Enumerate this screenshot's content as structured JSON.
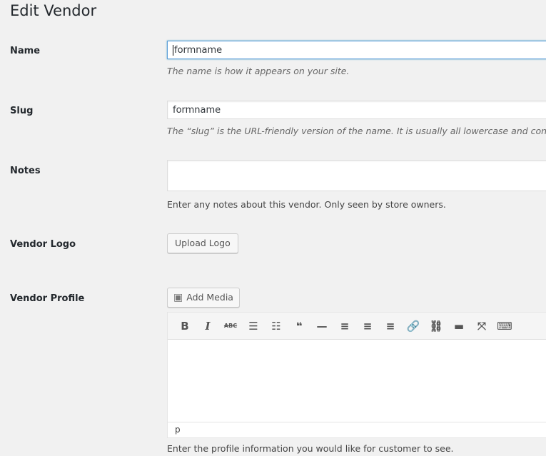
{
  "title": "Edit Vendor",
  "fields": {
    "name": {
      "label": "Name",
      "value": "formname",
      "description": "The name is how it appears on your site."
    },
    "slug": {
      "label": "Slug",
      "value": "formname",
      "description": "The “slug” is the URL-friendly version of the name. It is usually all lowercase and contain"
    },
    "notes": {
      "label": "Notes",
      "value": "",
      "description": "Enter any notes about this vendor. Only seen by store owners."
    },
    "logo": {
      "label": "Vendor Logo",
      "button": "Upload Logo"
    },
    "profile": {
      "label": "Vendor Profile",
      "add_media": "Add Media",
      "status_path": "p",
      "description": "Enter the profile information you would like for customer to see."
    }
  },
  "toolbar": [
    {
      "icon": "bold-icon",
      "glyph": "B"
    },
    {
      "icon": "italic-icon",
      "glyph": "I"
    },
    {
      "icon": "strikethrough-icon",
      "glyph": "ABC"
    },
    {
      "icon": "bullet-list-icon",
      "glyph": "☰"
    },
    {
      "icon": "numbered-list-icon",
      "glyph": "☷"
    },
    {
      "icon": "blockquote-icon",
      "glyph": "❝"
    },
    {
      "icon": "horizontal-line-icon",
      "glyph": "—"
    },
    {
      "icon": "align-left-icon",
      "glyph": "≡"
    },
    {
      "icon": "align-center-icon",
      "glyph": "≡"
    },
    {
      "icon": "align-right-icon",
      "glyph": "≡"
    },
    {
      "icon": "link-icon",
      "glyph": "🔗"
    },
    {
      "icon": "unlink-icon",
      "glyph": "⛓"
    },
    {
      "icon": "read-more-icon",
      "glyph": "▬"
    },
    {
      "icon": "fullscreen-icon",
      "glyph": "⤧"
    },
    {
      "icon": "toolbar-toggle-icon",
      "glyph": "⌨"
    }
  ]
}
